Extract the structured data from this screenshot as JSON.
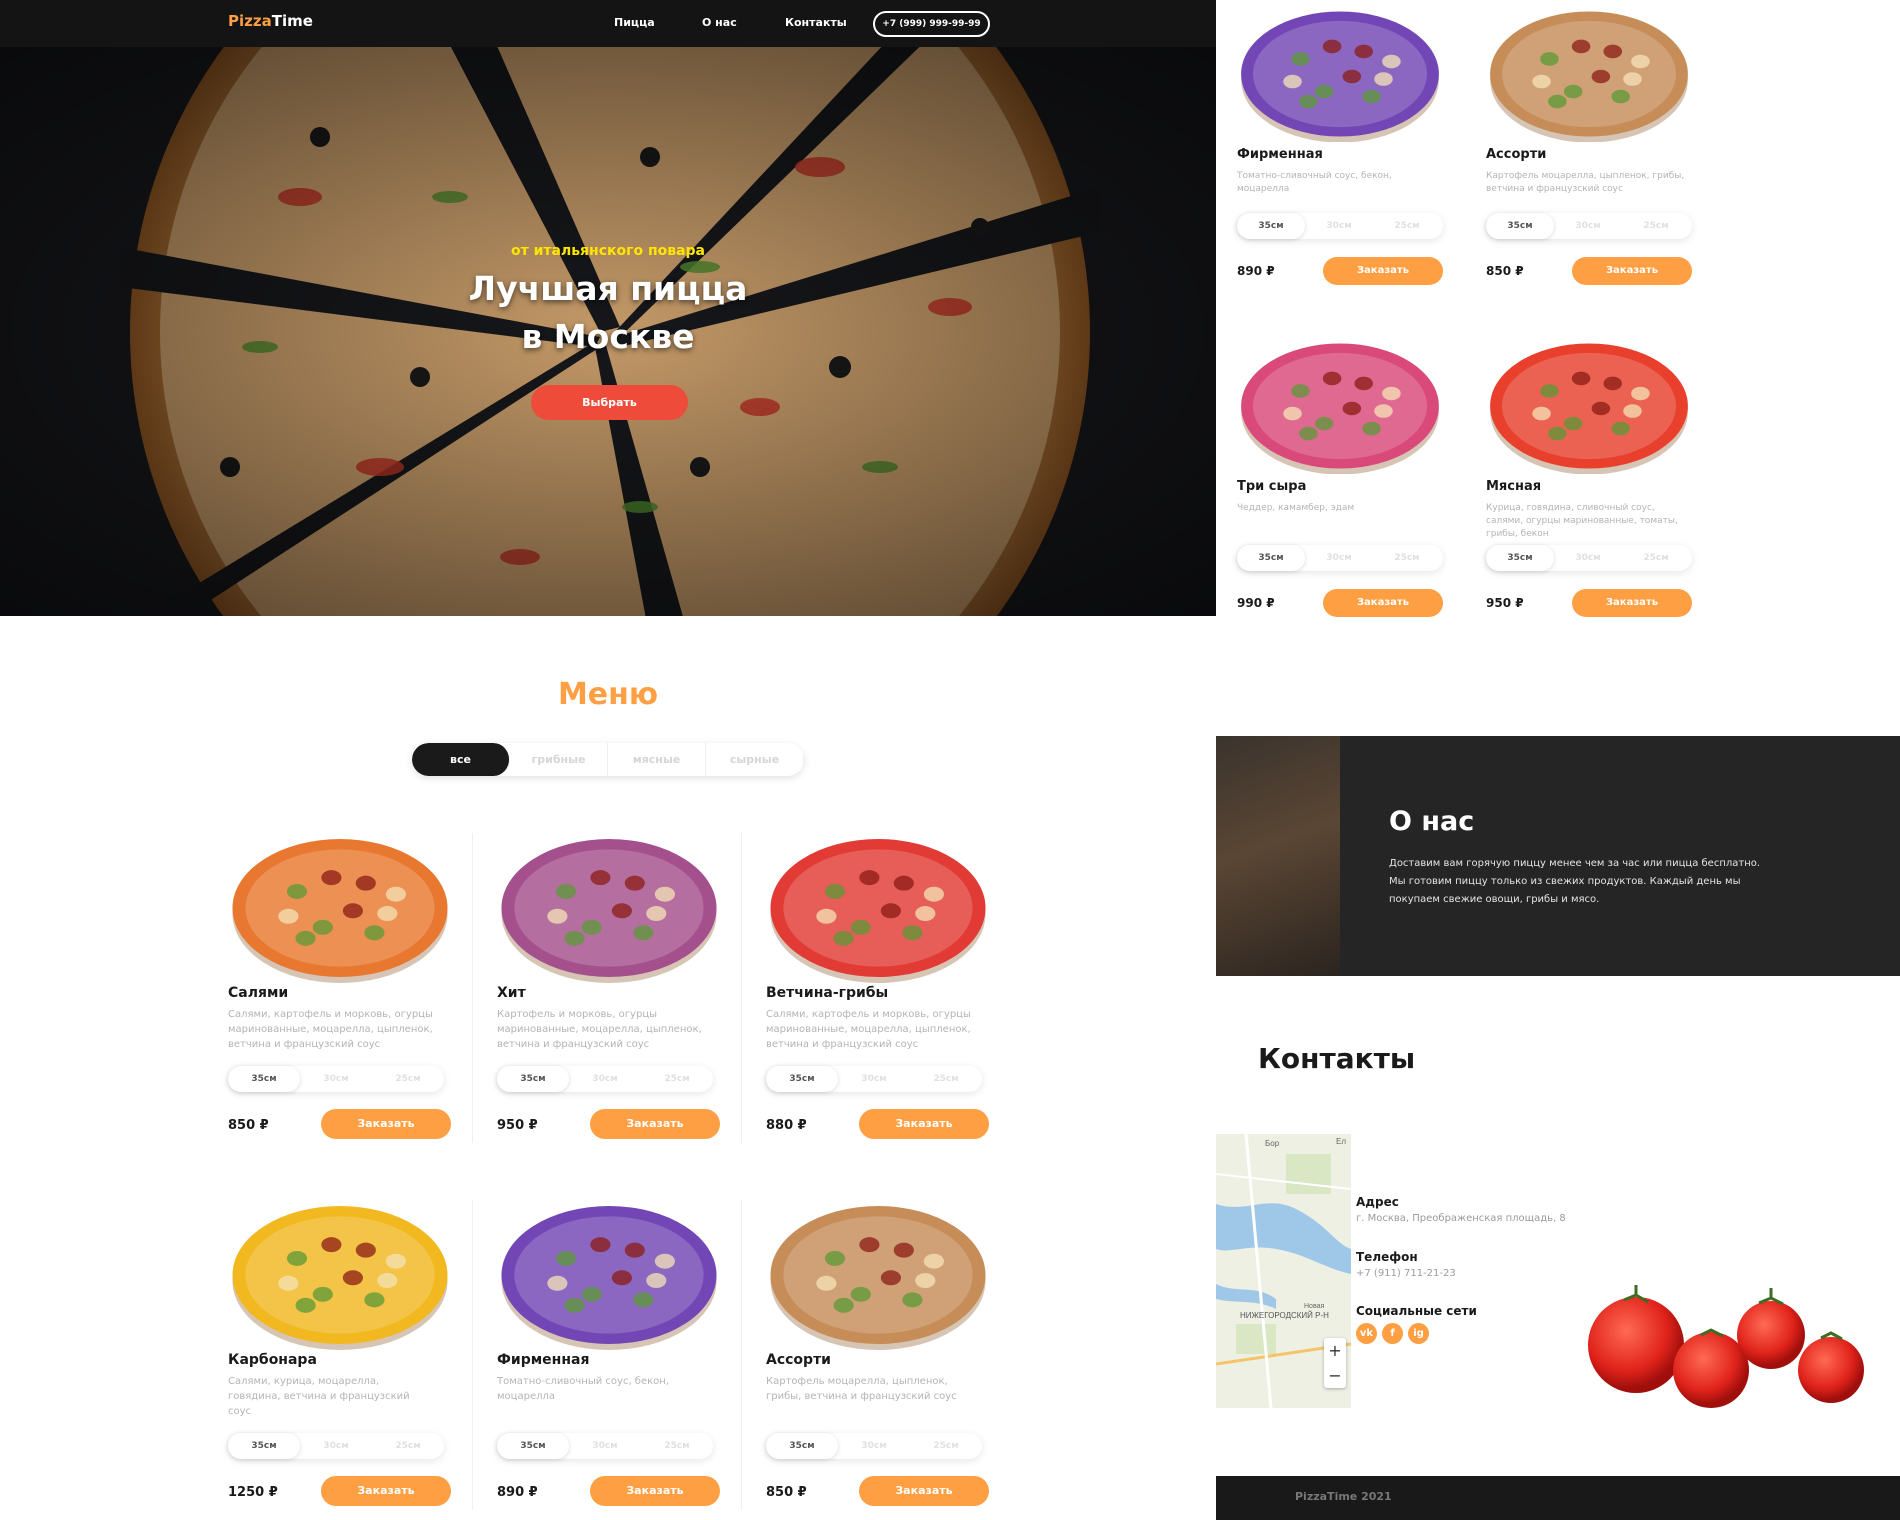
{
  "header": {
    "logo_part1": "Pizza",
    "logo_part2": "Time",
    "nav": [
      "Пицца",
      "О нас",
      "Контакты"
    ],
    "phone": "+7 (999) 999-99-99"
  },
  "hero": {
    "subtitle": "от итальянского повара",
    "title_line1": "Лучшая пицца",
    "title_line2": "в Москве",
    "button": "Выбрать"
  },
  "menu": {
    "title": "Меню",
    "filters": [
      "все",
      "грибные",
      "мясные",
      "сырные"
    ],
    "active_filter": "все",
    "sizes": [
      "35см",
      "30см",
      "25см"
    ],
    "selected_size": "35см",
    "order_label": "Заказать",
    "items": [
      {
        "name": "Салями",
        "desc": "Салями, картофель и морковь, огурцы маринованные, моцарелла, цыпленок, ветчина и французский соус",
        "price": "850 ₽",
        "color": "#e8782f"
      },
      {
        "name": "Хит",
        "desc": "Картофель и морковь, огурцы маринованные, моцарелла, цыпленок, ветчина и французский соус",
        "price": "950 ₽",
        "color": "#a4508c"
      },
      {
        "name": "Ветчина-грибы",
        "desc": "Салями, картофель и морковь, огурцы маринованные, моцарелла, цыпленок, ветчина и французский соус",
        "price": "880 ₽",
        "color": "#e23a34"
      },
      {
        "name": "Карбонара",
        "desc": "Салями, курица, моцарелла, говядина, ветчина и французский соус",
        "price": "1250 ₽",
        "color": "#f1b81f"
      },
      {
        "name": "Фирменная",
        "desc": "Томатно-сливочный соус, бекон, моцарелла",
        "price": "890 ₽",
        "color": "#7346b5"
      },
      {
        "name": "Ассорти",
        "desc": "Картофель моцарелла, цыпленок, грибы, ветчина и французский соус",
        "price": "850 ₽",
        "color": "#c68d59"
      }
    ],
    "items_right": [
      {
        "name": "Фирменная",
        "desc": "Томатно-сливочный соус, бекон, моцарелла",
        "price": "890 ₽",
        "color": "#7346b5"
      },
      {
        "name": "Ассорти",
        "desc": "Картофель моцарелла, цыпленок, грибы, ветчина и французский соус",
        "price": "850 ₽",
        "color": "#c68d59"
      },
      {
        "name": "Три сыра",
        "desc": "Чеддер, камамбер, эдам",
        "price": "990 ₽",
        "color": "#d9497a"
      },
      {
        "name": "Мясная",
        "desc": "Курица, говядина, сливочный соус, салями, огурцы маринованные, томаты, грибы, бекон",
        "price": "950 ₽",
        "color": "#e8402d"
      }
    ]
  },
  "about": {
    "title": "О нас",
    "text": "Доставим вам горячую пиццу менее чем за час или пицца бесплатно. Мы готовим пиццу только из свежих продуктов. Каждый день мы покупаем свежие овощи, грибы и мясо."
  },
  "contacts": {
    "title": "Контакты",
    "address_label": "Адрес",
    "address": "г. Москва, Преображенская площадь, 8",
    "phone_label": "Телефон",
    "phone": "+7 (911) 711-21-23",
    "social_label": "Социальные сети",
    "social": [
      "vk",
      "f",
      "ig"
    ],
    "map_labels": [
      "Бор",
      "Ел",
      "Новая",
      "НИЖЕГОРОДСКИЙ Р-Н"
    ],
    "map_zoom": [
      "+",
      "−"
    ]
  },
  "footer": {
    "text": "PizzaTime 2021"
  },
  "colors": {
    "accent": "#ff9f43",
    "hero_button": "#ef4b3a",
    "dark": "#141414"
  }
}
